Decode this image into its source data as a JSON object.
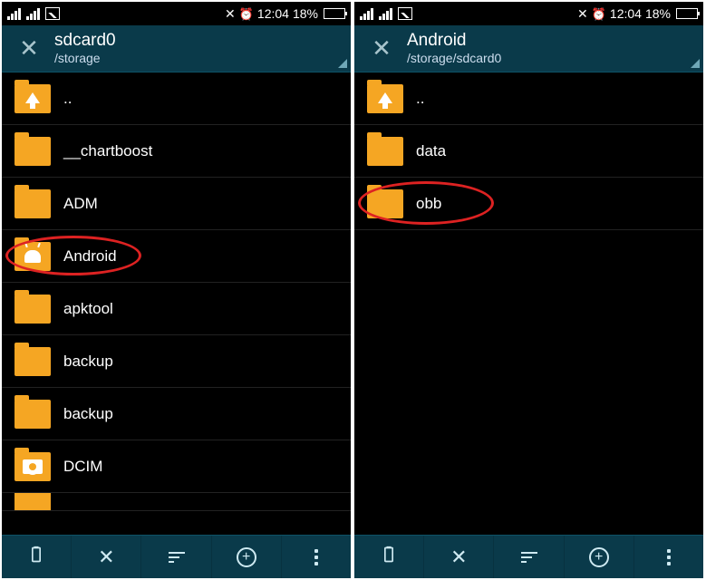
{
  "status": {
    "time": "12:04",
    "battery_percent": "18%"
  },
  "left": {
    "header_title": "sdcard0",
    "header_path": "/storage",
    "items": [
      {
        "label": "..",
        "icon": "up"
      },
      {
        "label": "__chartboost",
        "icon": "folder"
      },
      {
        "label": "ADM",
        "icon": "folder"
      },
      {
        "label": "Android",
        "icon": "android",
        "highlighted": true
      },
      {
        "label": "apktool",
        "icon": "folder"
      },
      {
        "label": "backup",
        "icon": "folder"
      },
      {
        "label": "backup",
        "icon": "folder"
      },
      {
        "label": "DCIM",
        "icon": "camera"
      }
    ]
  },
  "right": {
    "header_title": "Android",
    "header_path": "/storage/sdcard0",
    "items": [
      {
        "label": "..",
        "icon": "up"
      },
      {
        "label": "data",
        "icon": "folder"
      },
      {
        "label": "obb",
        "icon": "folder",
        "highlighted": true
      }
    ]
  },
  "bottombar": {
    "paste": "paste",
    "close": "close",
    "sort": "sort",
    "add": "add",
    "menu": "menu"
  }
}
